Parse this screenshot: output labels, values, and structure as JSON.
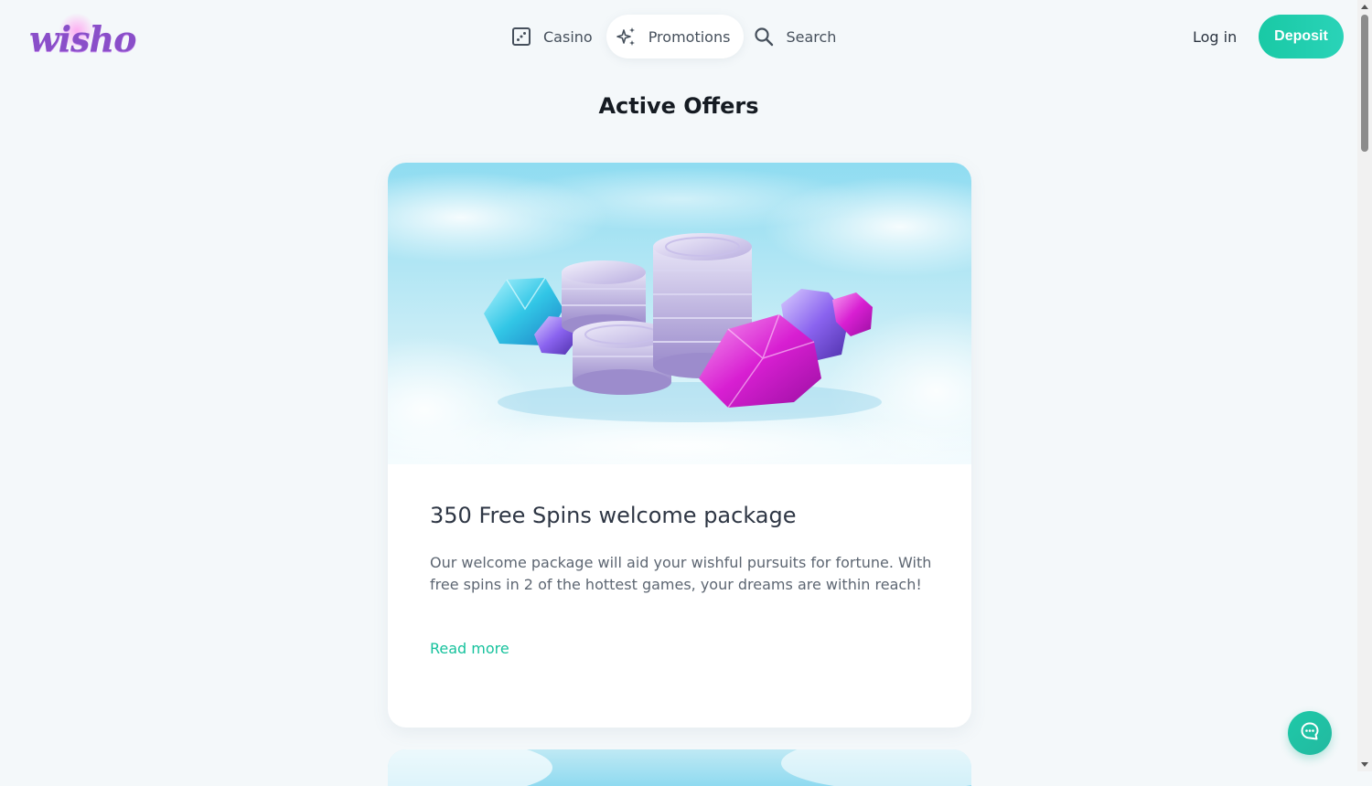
{
  "brand": {
    "logo_text": "wisho",
    "accent_color": "#1ec9a8",
    "logo_color": "#8a4fc9"
  },
  "nav": {
    "items": [
      {
        "label": "Casino",
        "icon": "dice-icon",
        "active": false
      },
      {
        "label": "Promotions",
        "icon": "sparkles-icon",
        "active": true
      },
      {
        "label": "Search",
        "icon": "search-icon",
        "active": false
      }
    ]
  },
  "header": {
    "login_label": "Log in",
    "deposit_label": "Deposit"
  },
  "page": {
    "title": "Active Offers"
  },
  "offers": [
    {
      "title": "350 Free Spins welcome package",
      "description": "Our welcome package will aid your wishful pursuits for fortune. With free spins in 2 of the hottest games, your dreams are within reach!",
      "link_label": "Read more",
      "image": "coins-and-gems-illustration"
    }
  ],
  "chat": {
    "icon": "chat-icon"
  }
}
